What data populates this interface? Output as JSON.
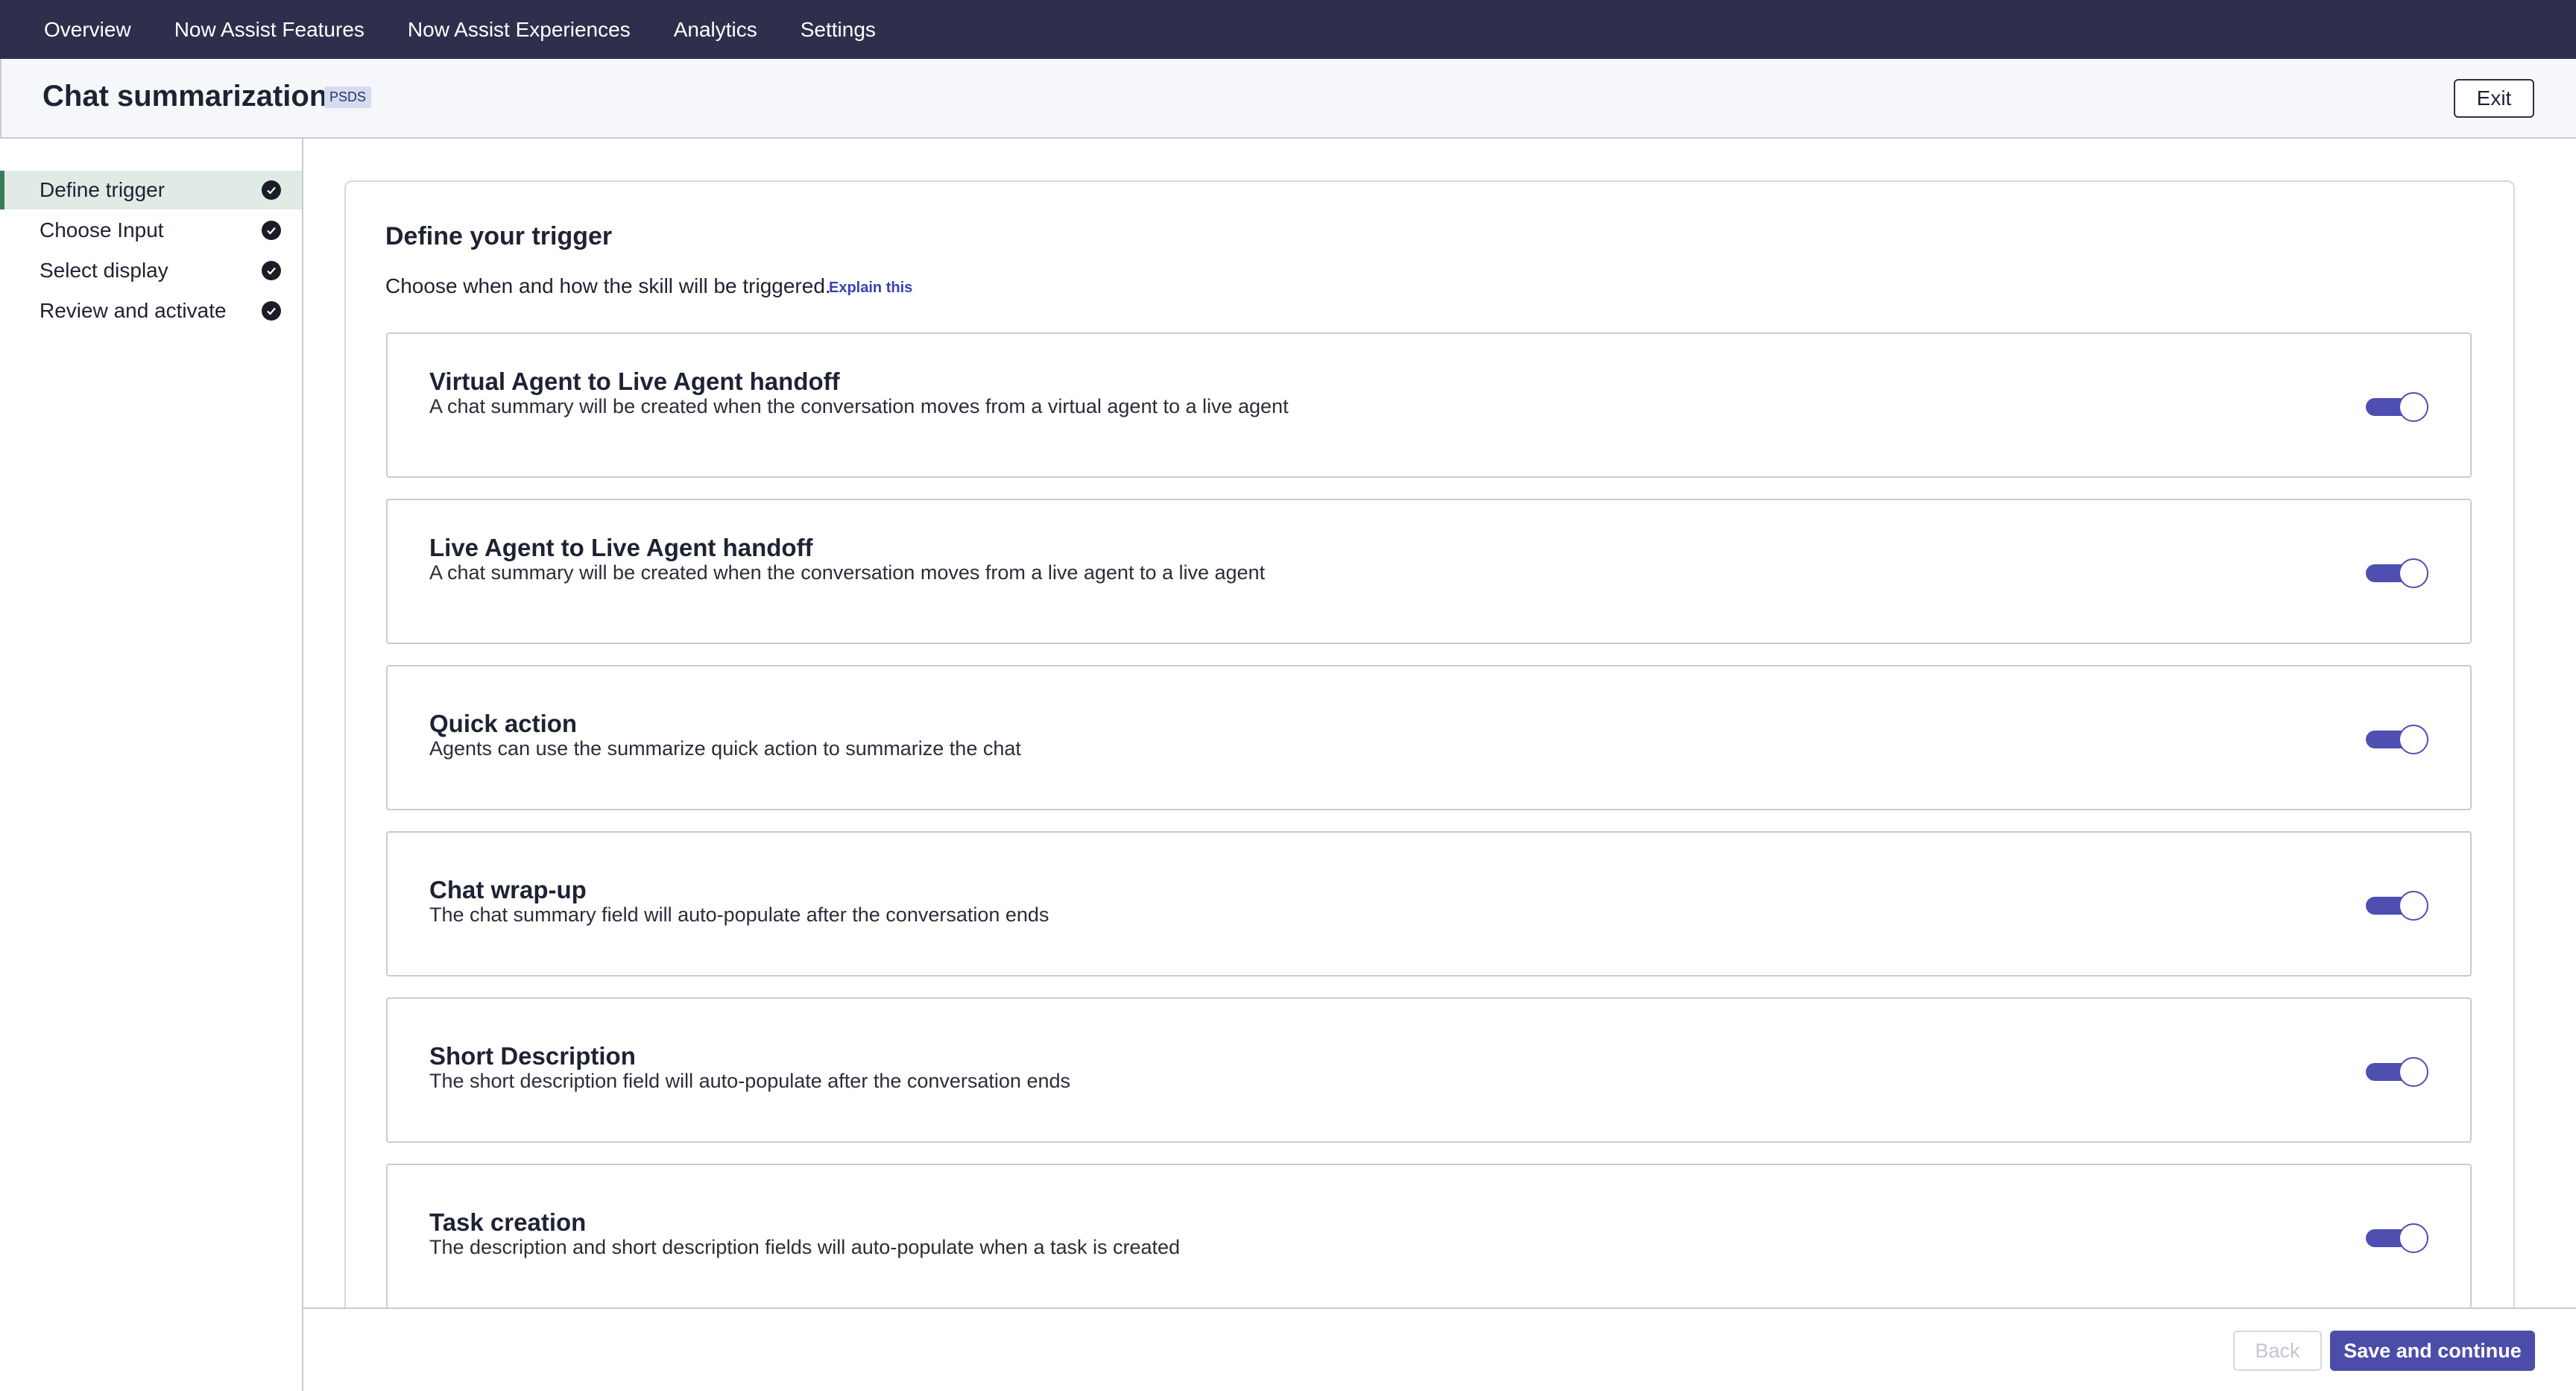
{
  "topnav": {
    "items": [
      "Overview",
      "Now Assist Features",
      "Now Assist Experiences",
      "Analytics",
      "Settings"
    ]
  },
  "header": {
    "title": "Chat summarization",
    "badge": "PSDS",
    "exit_label": "Exit"
  },
  "sidebar": {
    "steps": [
      {
        "label": "Define trigger",
        "status": "check-circle-icon"
      },
      {
        "label": "Choose Input",
        "status": "check-circle-icon"
      },
      {
        "label": "Select display",
        "status": "check-circle-icon"
      },
      {
        "label": "Review and activate",
        "status": "check-circle-icon"
      }
    ]
  },
  "main": {
    "heading": "Define your trigger",
    "subtitle": "Choose when and how the skill will be triggered.",
    "explain_link": "Explain this",
    "options": [
      {
        "title": "Virtual Agent to Live Agent handoff",
        "description": "A chat summary will be created when the conversation moves from a virtual agent to a live agent",
        "enabled": true
      },
      {
        "title": "Live Agent to Live Agent handoff",
        "description": "A chat summary will be created when the conversation moves from a live agent to a live agent",
        "enabled": true
      },
      {
        "title": "Quick action",
        "description": "Agents can use the summarize quick action to summarize the chat",
        "enabled": true
      },
      {
        "title": "Chat wrap-up",
        "description": "The chat summary field will auto-populate after the conversation ends",
        "enabled": true
      },
      {
        "title": "Short Description",
        "description": "The short description field will auto-populate after the conversation ends",
        "enabled": true
      },
      {
        "title": "Task creation",
        "description": "The description and short description fields will auto-populate when a task is created",
        "enabled": true
      }
    ]
  },
  "footer": {
    "back_label": "Back",
    "save_label": "Save and continue"
  },
  "colors": {
    "nav_bg": "#2e2f4c",
    "accent": "#4e4fb0",
    "active_step_bg": "#e0ebe5",
    "active_step_bar": "#3a7d55"
  }
}
